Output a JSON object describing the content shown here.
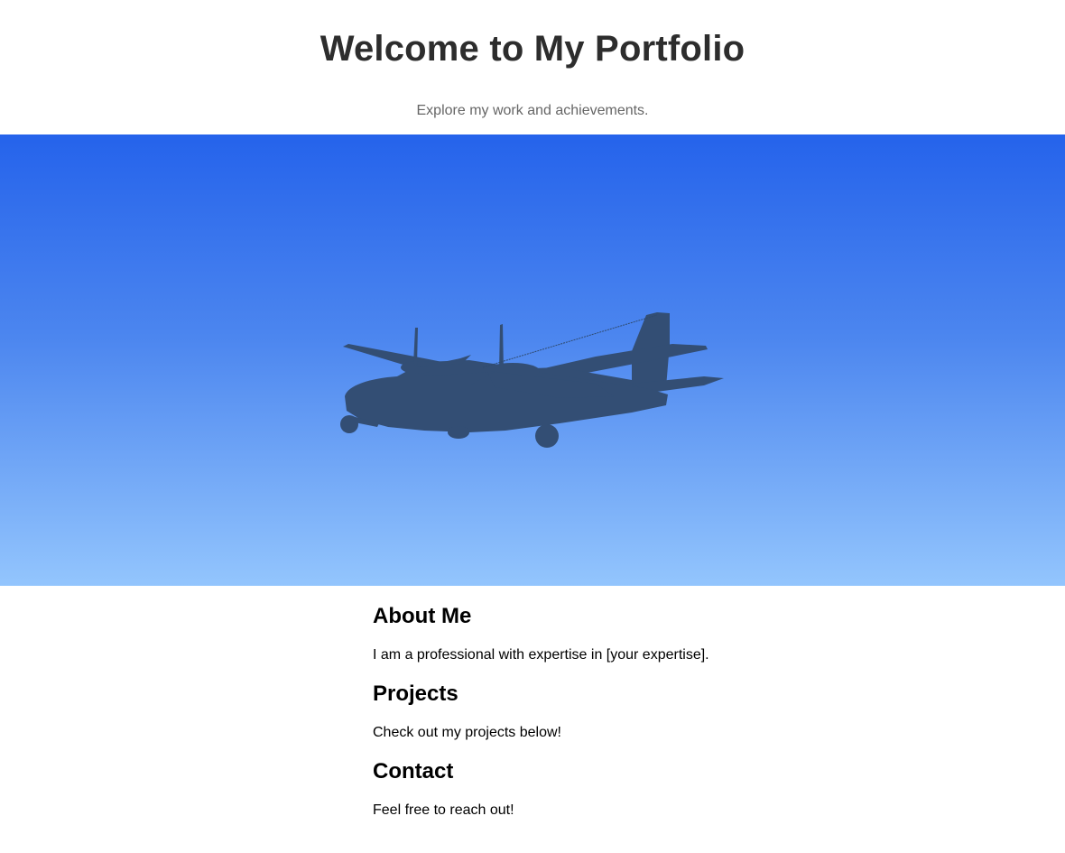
{
  "header": {
    "title": "Welcome to My Portfolio",
    "subtitle": "Explore my work and achievements."
  },
  "hero": {
    "image": "airplane-illustration",
    "sky_gradient": [
      "#2563eb",
      "#93c5fd"
    ],
    "plane_color": "#334e74"
  },
  "sections": [
    {
      "heading": "About Me",
      "text": "I am a professional with expertise in [your expertise]."
    },
    {
      "heading": "Projects",
      "text": "Check out my projects below!"
    },
    {
      "heading": "Contact",
      "text": "Feel free to reach out!"
    }
  ]
}
